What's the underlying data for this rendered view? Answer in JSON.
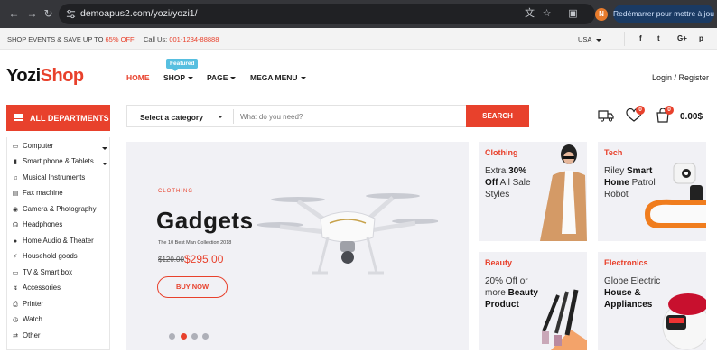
{
  "browser": {
    "url": "demoapus2.com/yozi/yozi1/",
    "avatar_letter": "N",
    "restart_label": "Redémarrer pour mettre à jour"
  },
  "topbar": {
    "promo_text": "SHOP EVENTS & SAVE UP TO ",
    "promo_highlight": "65% OFF!",
    "call_label": "Call Us: ",
    "call_number": "001-1234-88888",
    "country": "USA",
    "socials": [
      "f",
      "t",
      "G+",
      "p"
    ]
  },
  "header": {
    "logo_a": "Yozi",
    "logo_b": "Shop",
    "featured_badge": "Featured",
    "menu": [
      "HOME",
      "SHOP",
      "PAGE",
      "MEGA MENU"
    ],
    "login": "Login / Register",
    "wishlist_count": "0",
    "cart_count": "0",
    "cart_total": "0.00$"
  },
  "departments": {
    "label": "ALL DEPARTMENTS",
    "items": [
      "Computer",
      "Smart phone & Tablets",
      "Musical Instruments",
      "Fax machine",
      "Camera & Photography",
      "Headphones",
      "Home Audio & Theater",
      "Household goods",
      "TV & Smart box",
      "Accessories",
      "Printer",
      "Watch",
      "Other"
    ]
  },
  "search": {
    "category": "Select a category",
    "placeholder": "What do you need?",
    "button": "SEARCH"
  },
  "hero": {
    "kicker": "CLOTHING",
    "title": "Gadgets",
    "subtitle": "The 10 Best Man Collection 2018",
    "old_price": "$120.00",
    "new_price": "$295.00",
    "button": "BUY NOW",
    "slide_active": 2,
    "slide_count": 4
  },
  "cards": {
    "clothing": {
      "title": "Clothing",
      "l1a": "Extra ",
      "l1b": "30%",
      "l2a": "Off",
      "l2b": " All Sale",
      "l3": "Styles"
    },
    "tech": {
      "title": "Tech",
      "l1a": "Riley ",
      "l1b": "Smart",
      "l2a": "Home",
      "l2b": " Patrol",
      "l3": "Robot"
    },
    "beauty": {
      "title": "Beauty",
      "l1": "20% Off or",
      "l2a": "more ",
      "l2b": "Beauty",
      "l3": "Product"
    },
    "electronics": {
      "title": "Electronics",
      "l1": "Globe Electric",
      "l2": "House &",
      "l3": "Appliances"
    }
  },
  "colors": {
    "accent": "#e8412c",
    "featured": "#57bfe0"
  }
}
